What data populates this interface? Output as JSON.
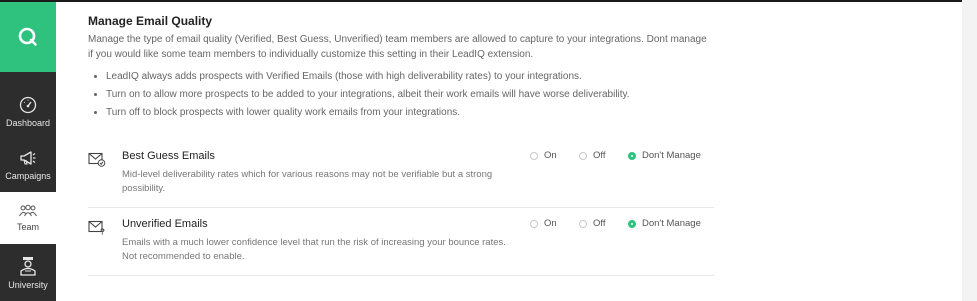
{
  "sidebar": {
    "items": [
      {
        "label": "Dashboard",
        "icon": "dashboard-icon"
      },
      {
        "label": "Campaigns",
        "icon": "megaphone-icon"
      },
      {
        "label": "Team",
        "icon": "team-icon"
      },
      {
        "label": "University",
        "icon": "university-icon"
      }
    ],
    "active": "Team",
    "brand_color": "#2ec27e"
  },
  "section": {
    "title": "Manage Email Quality",
    "description": "Manage the type of email quality (Verified, Best Guess, Unverified) team members are allowed to capture to your integrations. Dont manage if you would like some team members to individually customize this setting in their LeadIQ extension.",
    "bullets": [
      "LeadIQ always adds prospects with Verified Emails (those with high deliverability rates) to your integrations.",
      "Turn on to allow more prospects to be added to your integrations, albeit their work emails will have worse deliverability.",
      "Turn off to block prospects with lower quality work emails from your integrations."
    ]
  },
  "settings": [
    {
      "name": "Best Guess Emails",
      "icon": "email-check-icon",
      "description": "Mid-level deliverability rates which for various reasons may not be verifiable but a strong possibility.",
      "options": {
        "on": "On",
        "off": "Off",
        "dont_manage": "Don't Manage"
      },
      "selected": "Don't Manage"
    },
    {
      "name": "Unverified Emails",
      "icon": "email-question-icon",
      "description": "Emails with a much lower confidence level that run the risk of increasing your bounce rates. Not recommended to enable.",
      "options": {
        "on": "On",
        "off": "Off",
        "dont_manage": "Don't Manage"
      },
      "selected": "Don't Manage"
    }
  ]
}
